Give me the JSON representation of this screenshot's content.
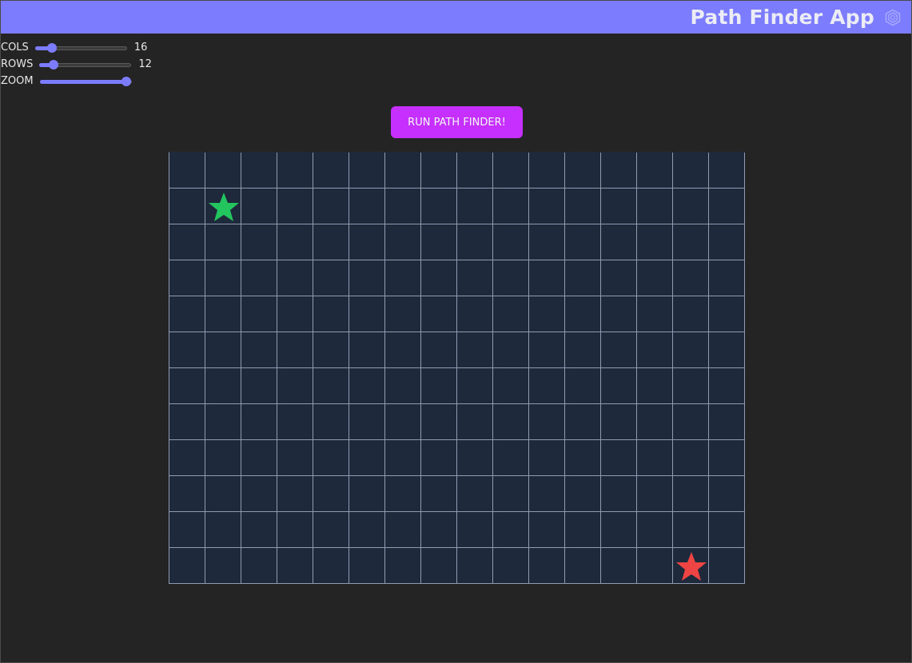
{
  "header": {
    "title": "Path Finder App",
    "logo_icon": "hexagon-logo-icon"
  },
  "controls": {
    "cols": {
      "label": "COLS",
      "value": "16",
      "min": 2,
      "max": 100,
      "current": 16
    },
    "rows": {
      "label": "ROWS",
      "value": "12",
      "min": 2,
      "max": 100,
      "current": 12
    },
    "zoom": {
      "label": "ZOOM",
      "level_fraction": 1.0
    }
  },
  "run_button": {
    "label": "RUN PATH FINDER!"
  },
  "grid": {
    "cols": 16,
    "rows": 12,
    "start": {
      "col": 1,
      "row": 1,
      "icon": "star-icon",
      "color": "#22c55e"
    },
    "end": {
      "col": 14,
      "row": 11,
      "icon": "star-icon",
      "color": "#ef4444"
    }
  },
  "colors": {
    "accent": "#7b7cff",
    "button": "#c530ff",
    "grid_bg": "#1e293b",
    "grid_line": "#8f9bb0",
    "page_bg": "#242424"
  }
}
